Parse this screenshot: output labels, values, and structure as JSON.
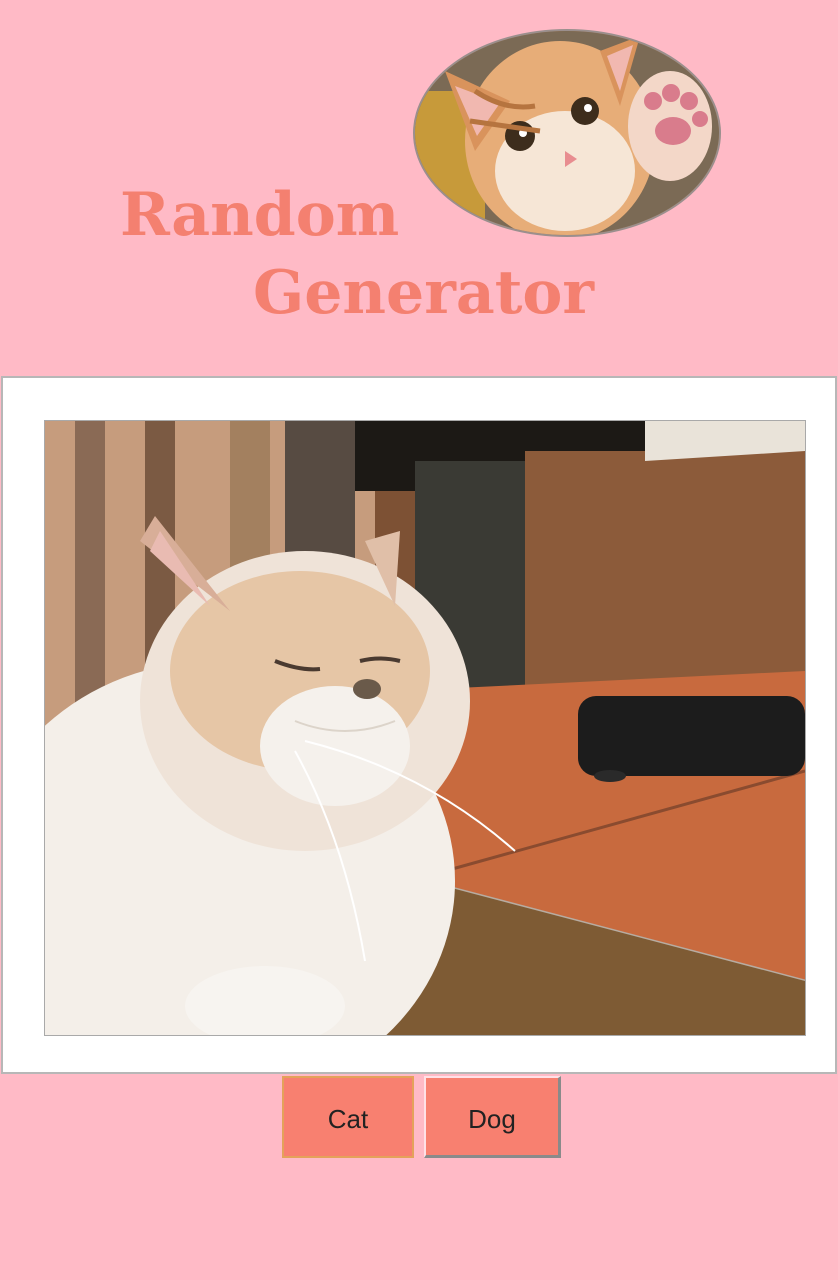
{
  "header": {
    "title_line1": "Random",
    "title_line2": "Generator",
    "avatar_icon": "cat-waving-photo"
  },
  "main": {
    "photo_icon": "cat-photo"
  },
  "buttons": {
    "cat_label": "Cat",
    "dog_label": "Dog"
  },
  "colors": {
    "background": "#ffbac6",
    "title": "#f48070",
    "button": "#f88070"
  }
}
